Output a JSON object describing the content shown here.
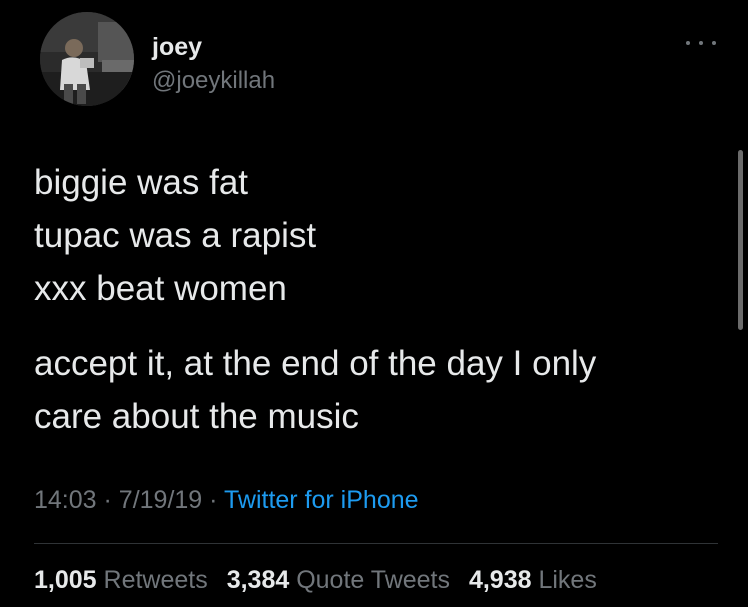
{
  "author": {
    "display_name": "joey",
    "handle": "@joeykillah",
    "avatar": "profile-photo"
  },
  "tweet": {
    "lines": [
      "biggie was fat",
      "tupac was a rapist",
      "xxx beat women"
    ],
    "paragraph_2": [
      "accept it, at the end of the day I only",
      "care about the music"
    ]
  },
  "meta": {
    "time": "14:03",
    "date": "7/19/19",
    "separator": "·",
    "source": "Twitter for iPhone"
  },
  "stats": {
    "retweets": {
      "count": "1,005",
      "label": "Retweets"
    },
    "quote_tweets": {
      "count": "3,384",
      "label": "Quote Tweets"
    },
    "likes": {
      "count": "4,938",
      "label": "Likes"
    }
  },
  "icons": {
    "more": "more-options-icon"
  },
  "colors": {
    "background": "#000000",
    "text": "#e7e9ea",
    "secondary": "#71767b",
    "link": "#1d9bf0"
  }
}
